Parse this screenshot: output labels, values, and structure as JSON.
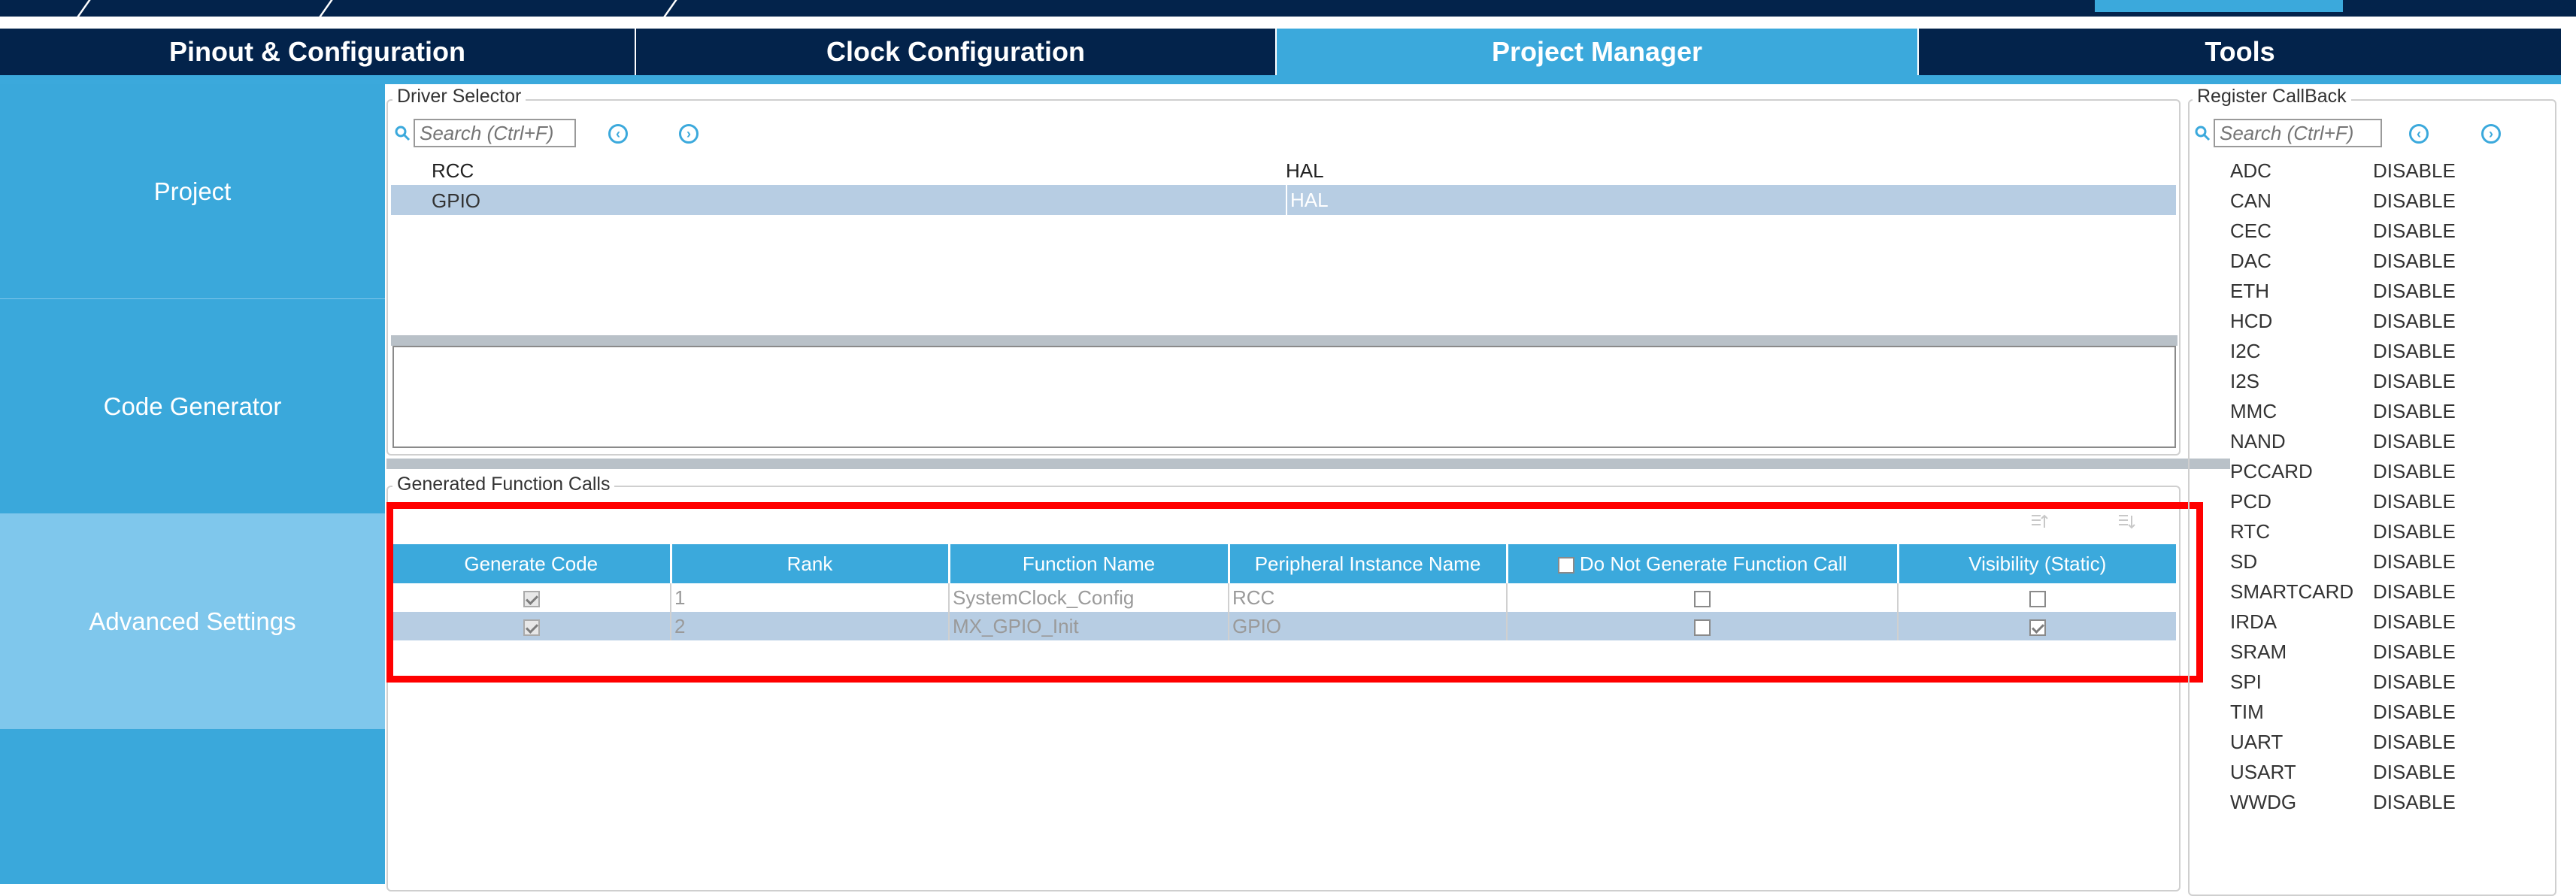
{
  "tabs": [
    {
      "label": "Pinout & Configuration",
      "active": false
    },
    {
      "label": "Clock Configuration",
      "active": false
    },
    {
      "label": "Project Manager",
      "active": true
    },
    {
      "label": "Tools",
      "active": false
    }
  ],
  "sidebar": {
    "items": [
      {
        "label": "Project",
        "active": false
      },
      {
        "label": "Code Generator",
        "active": false
      },
      {
        "label": "Advanced Settings",
        "active": true
      }
    ]
  },
  "driver_selector": {
    "title": "Driver Selector",
    "search_placeholder": "Search (Ctrl+F)",
    "rows": [
      {
        "name": "RCC",
        "driver": "HAL"
      },
      {
        "name": "GPIO",
        "driver": "HAL"
      }
    ]
  },
  "generated_calls": {
    "title": "Generated Function Calls",
    "headers": {
      "generate_code": "Generate Code",
      "rank": "Rank",
      "function_name": "Function Name",
      "peripheral": "Peripheral Instance Name",
      "do_not_generate": "Do Not Generate Function Call",
      "visibility": "Visibility (Static)"
    },
    "rows": [
      {
        "generate": true,
        "rank": "1",
        "function": "SystemClock_Config",
        "peripheral": "RCC",
        "do_not_generate": false,
        "static": false
      },
      {
        "generate": true,
        "rank": "2",
        "function": "MX_GPIO_Init",
        "peripheral": "GPIO",
        "do_not_generate": false,
        "static": true
      }
    ]
  },
  "register_callback": {
    "title": "Register CallBack",
    "search_placeholder": "Search (Ctrl+F)",
    "items": [
      {
        "name": "ADC",
        "value": "DISABLE"
      },
      {
        "name": "CAN",
        "value": "DISABLE"
      },
      {
        "name": "CEC",
        "value": "DISABLE"
      },
      {
        "name": "DAC",
        "value": "DISABLE"
      },
      {
        "name": "ETH",
        "value": "DISABLE"
      },
      {
        "name": "HCD",
        "value": "DISABLE"
      },
      {
        "name": "I2C",
        "value": "DISABLE"
      },
      {
        "name": "I2S",
        "value": "DISABLE"
      },
      {
        "name": "MMC",
        "value": "DISABLE"
      },
      {
        "name": "NAND",
        "value": "DISABLE"
      },
      {
        "name": "PCCARD",
        "value": "DISABLE"
      },
      {
        "name": "PCD",
        "value": "DISABLE"
      },
      {
        "name": "RTC",
        "value": "DISABLE"
      },
      {
        "name": "SD",
        "value": "DISABLE"
      },
      {
        "name": "SMARTCARD",
        "value": "DISABLE"
      },
      {
        "name": "IRDA",
        "value": "DISABLE"
      },
      {
        "name": "SRAM",
        "value": "DISABLE"
      },
      {
        "name": "SPI",
        "value": "DISABLE"
      },
      {
        "name": "TIM",
        "value": "DISABLE"
      },
      {
        "name": "UART",
        "value": "DISABLE"
      },
      {
        "name": "USART",
        "value": "DISABLE"
      },
      {
        "name": "WWDG",
        "value": "DISABLE"
      }
    ]
  },
  "colors": {
    "navy": "#03234b",
    "accent": "#3ba9dc",
    "selection": "#b7cde3",
    "highlight": "#ff0000"
  }
}
